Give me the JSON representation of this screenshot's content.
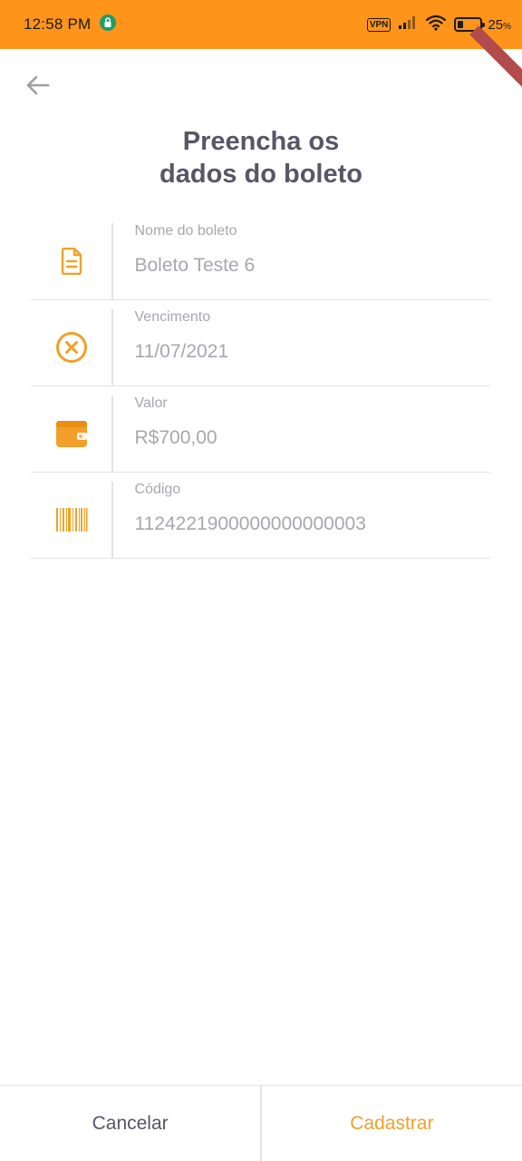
{
  "status_bar": {
    "time": "12:58 PM",
    "vpn": "VPN",
    "battery_percent": "25",
    "battery_unit": "%",
    "battery_level": 0.25,
    "background": "#FF941A"
  },
  "header": {
    "back_icon": "arrow-left-icon",
    "title_line1": "Preencha os",
    "title_line2": "dados do boleto"
  },
  "form": {
    "fields": [
      {
        "label": "Nome do boleto",
        "value": "Boleto Teste 6",
        "icon": "document-icon"
      },
      {
        "label": "Vencimento",
        "value": "11/07/2021",
        "icon": "close-circle-icon"
      },
      {
        "label": "Valor",
        "value": "R$700,00",
        "icon": "wallet-icon"
      },
      {
        "label": "Código",
        "value": "1124221900000000000003",
        "icon": "barcode-icon"
      }
    ]
  },
  "actions": {
    "cancel_label": "Cancelar",
    "register_label": "Cadastrar"
  },
  "colors": {
    "accent": "#F2A029",
    "title": "#585666",
    "muted_text": "#A7A7AE",
    "divider": "#E3E3E6"
  }
}
